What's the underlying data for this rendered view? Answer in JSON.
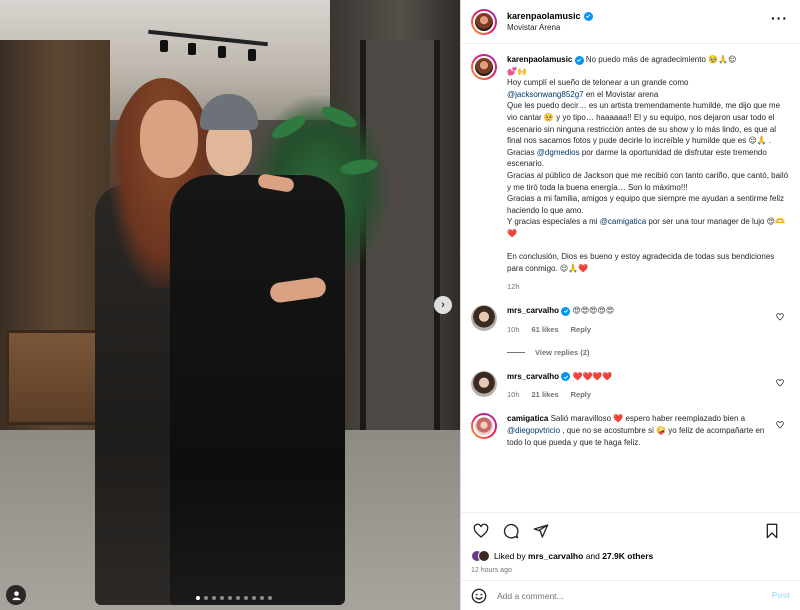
{
  "post": {
    "username": "karenpaolamusic",
    "location": "Movistar Arena",
    "photo": {
      "total_slides": 10,
      "active_slide": 1
    }
  },
  "caption": {
    "username": "karenpaolamusic",
    "line1": "No puedo más de agradecimiento 🥹🙏😌",
    "line2": "💕🙌",
    "line3": "Hoy cumplí el sueño de telonear a un grande como",
    "mention1": "@jacksonwang852g7",
    "line4": " en el Movistar arena",
    "line5": "Que les puedo decir… es un artista tremendamente humilde, me dijo que me vio cantar 🥺 y yo tipo… haaaaaa!! El y su equipo, nos dejaron usar todo el escenario sin ninguna restricción antes de su show y lo más lindo, es que al final nos sacamos fotos y pude decirle lo increíble y humilde que es 😌🙏 .",
    "line6a": "Gracias ",
    "mention2": "@dgmedios",
    "line6b": " por darme la oportunidad de disfrutar este tremendo escenario.",
    "line7": "Gracias al público de Jackson que me recibió con tanto cariño, que cantó, bailó y me tiró toda la buena energía… Son lo máximo!!!",
    "line8": "Gracias a mi familia, amigos y equipo que siempre me ayudan a sentirme feliz haciendo lo que amo.",
    "line9a": "Y gracias especiales a mi ",
    "mention3": "@camigatica",
    "line9b": " por ser una tour manager de lujo 😍🫶❤️",
    "line10": "En conclusión, Dios es bueno y estoy agradecida de todas sus bendiciones para conmigo. 😌🙏❤️",
    "time": "12h"
  },
  "comments": [
    {
      "username": "mrs_carvalho",
      "verified": true,
      "text": "😍😍😍😍😍",
      "time": "10h",
      "likes": "61 likes",
      "reply": "Reply"
    },
    {
      "username": "mrs_carvalho",
      "verified": true,
      "text": "❤️❤️❤️❤️",
      "time": "10h",
      "likes": "21 likes",
      "reply": "Reply"
    },
    {
      "username": "camigatica",
      "verified": false,
      "text_a": "Salió maravilloso ❤️ espero haber reemplazado bien a ",
      "mention": "@diegopvtricio",
      "text_b": " , que no se acostumbre si 🤪 yo feliz de acompañarte en todo lo que pueda y que te haga feliz."
    }
  ],
  "view_replies": "View replies (2)",
  "likes": {
    "prefix": "Liked by ",
    "user": "mrs_carvalho",
    "joiner": " and ",
    "others": "27.9K others"
  },
  "posted_ago": "12 hours ago",
  "add_comment": {
    "placeholder": "Add a comment...",
    "post_label": "Post"
  },
  "colors": {
    "link": "#00376b",
    "verified": "#0095f6",
    "like_red": "#ed4956",
    "post_disabled": "#b2dffc"
  }
}
